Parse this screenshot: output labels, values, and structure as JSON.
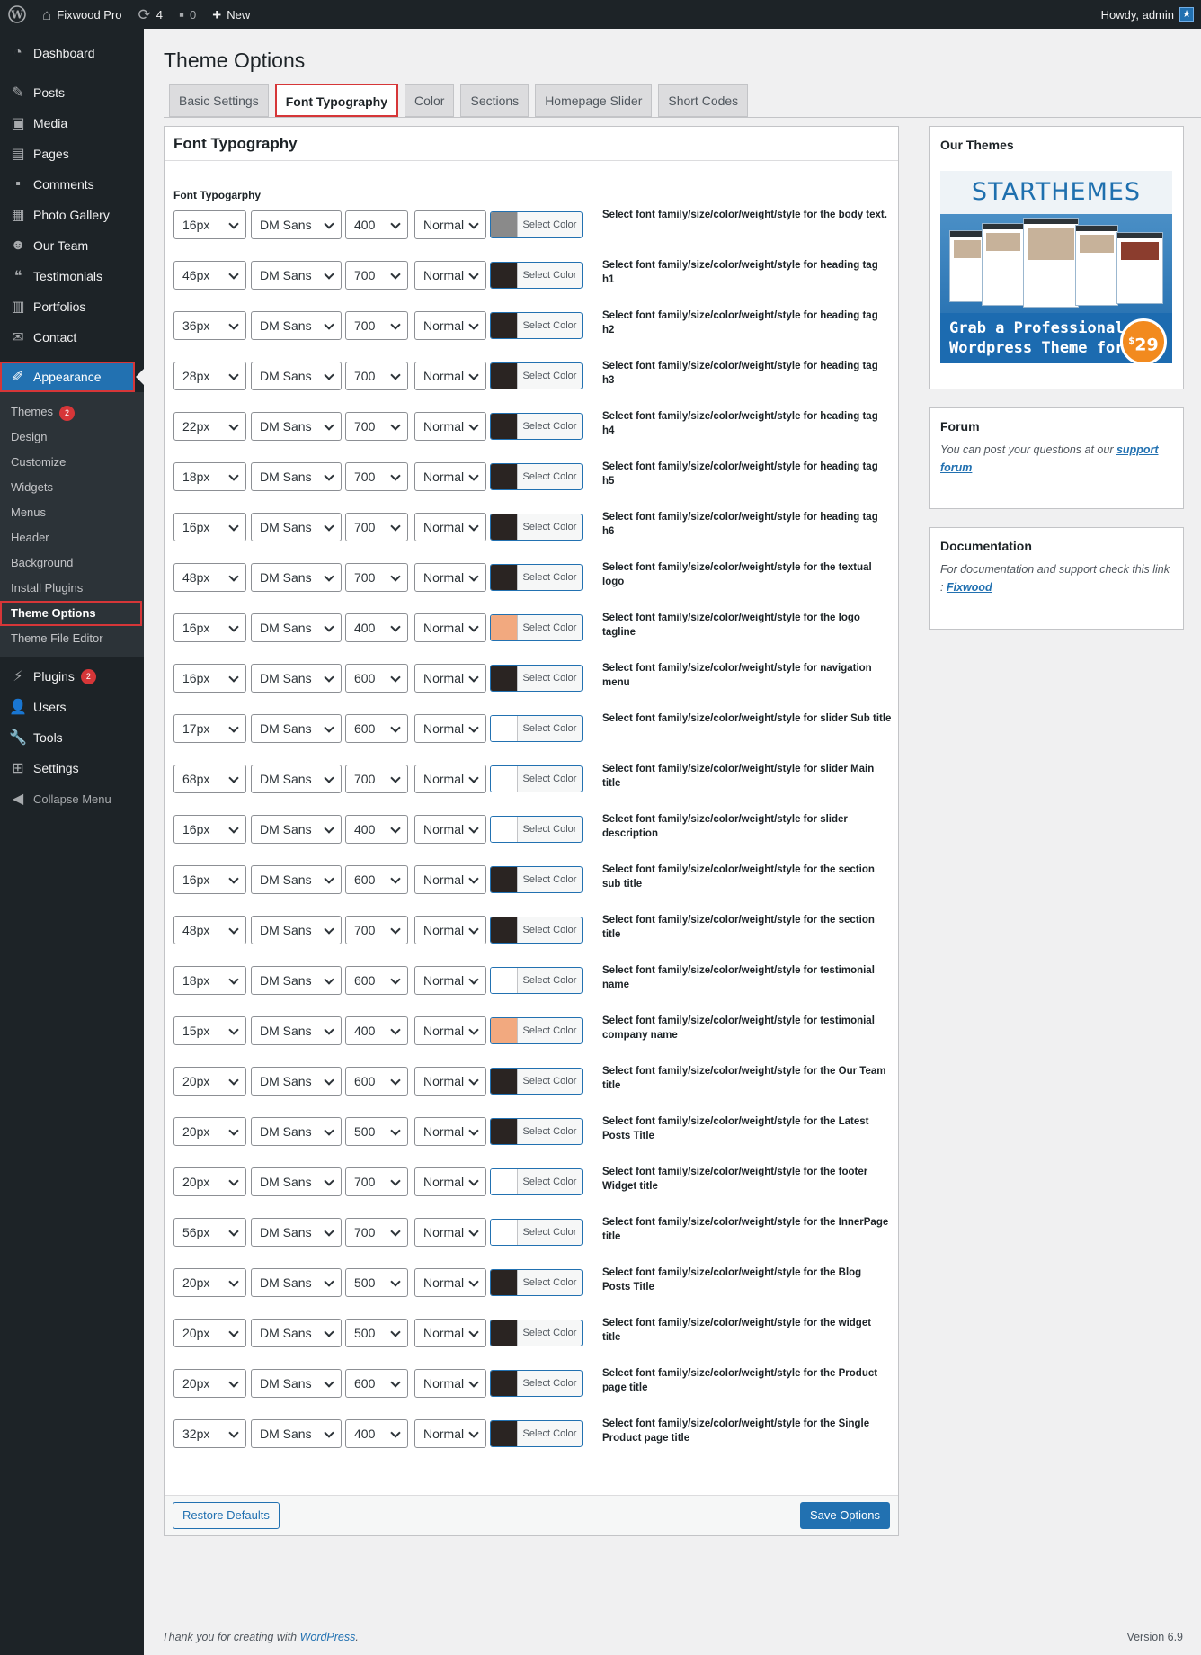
{
  "adminbar": {
    "site_name": "Fixwood Pro",
    "updates_count": "4",
    "comments_count": "0",
    "new_label": "New",
    "howdy": "Howdy, admin"
  },
  "sidebar": {
    "items": [
      {
        "label": "Dashboard",
        "icon": "dashboard-icon"
      },
      {
        "label": "Posts",
        "icon": "pin-icon"
      },
      {
        "label": "Media",
        "icon": "media-icon"
      },
      {
        "label": "Pages",
        "icon": "pages-icon"
      },
      {
        "label": "Comments",
        "icon": "comment-icon"
      },
      {
        "label": "Photo Gallery",
        "icon": "gallery-icon"
      },
      {
        "label": "Our Team",
        "icon": "team-icon"
      },
      {
        "label": "Testimonials",
        "icon": "quote-icon"
      },
      {
        "label": "Portfolios",
        "icon": "portfolio-icon"
      },
      {
        "label": "Contact",
        "icon": "mail-icon"
      },
      {
        "label": "Appearance",
        "icon": "brush-icon"
      }
    ],
    "submenu": [
      {
        "label": "Themes",
        "badge": "2"
      },
      {
        "label": "Design"
      },
      {
        "label": "Customize"
      },
      {
        "label": "Widgets"
      },
      {
        "label": "Menus"
      },
      {
        "label": "Header"
      },
      {
        "label": "Background"
      },
      {
        "label": "Install Plugins"
      },
      {
        "label": "Theme Options"
      },
      {
        "label": "Theme File Editor"
      }
    ],
    "after": [
      {
        "label": "Plugins",
        "icon": "plugin-icon",
        "badge": "2"
      },
      {
        "label": "Users",
        "icon": "user-icon"
      },
      {
        "label": "Tools",
        "icon": "wrench-icon"
      },
      {
        "label": "Settings",
        "icon": "settings-icon"
      }
    ],
    "collapse_label": "Collapse Menu"
  },
  "page": {
    "title": "Theme Options",
    "tabs": [
      "Basic Settings",
      "Font Typography",
      "Color",
      "Sections",
      "Homepage Slider",
      "Short Codes"
    ],
    "panel_title": "Font Typography",
    "section_label": "Font Typogarphy",
    "select_color_label": "Select Color",
    "rows": [
      {
        "size": "16px",
        "family": "DM Sans",
        "weight": "400",
        "style": "Normal",
        "color": "#8a8a8a",
        "desc": "Select font family/size/color/weight/style for the body text."
      },
      {
        "size": "46px",
        "family": "DM Sans",
        "weight": "700",
        "style": "Normal",
        "color": "#2a2422",
        "desc": "Select font family/size/color/weight/style for heading tag h1"
      },
      {
        "size": "36px",
        "family": "DM Sans",
        "weight": "700",
        "style": "Normal",
        "color": "#2a2422",
        "desc": "Select font family/size/color/weight/style for heading tag h2"
      },
      {
        "size": "28px",
        "family": "DM Sans",
        "weight": "700",
        "style": "Normal",
        "color": "#2a2422",
        "desc": "Select font family/size/color/weight/style for heading tag h3"
      },
      {
        "size": "22px",
        "family": "DM Sans",
        "weight": "700",
        "style": "Normal",
        "color": "#2a2422",
        "desc": "Select font family/size/color/weight/style for heading tag h4"
      },
      {
        "size": "18px",
        "family": "DM Sans",
        "weight": "700",
        "style": "Normal",
        "color": "#2a2422",
        "desc": "Select font family/size/color/weight/style for heading tag h5"
      },
      {
        "size": "16px",
        "family": "DM Sans",
        "weight": "700",
        "style": "Normal",
        "color": "#2a2422",
        "desc": "Select font family/size/color/weight/style for heading tag h6"
      },
      {
        "size": "48px",
        "family": "DM Sans",
        "weight": "700",
        "style": "Normal",
        "color": "#2a2422",
        "desc": "Select font family/size/color/weight/style for the textual logo"
      },
      {
        "size": "16px",
        "family": "DM Sans",
        "weight": "400",
        "style": "Normal",
        "color": "#f2a97f",
        "desc": "Select font family/size/color/weight/style for the logo tagline"
      },
      {
        "size": "16px",
        "family": "DM Sans",
        "weight": "600",
        "style": "Normal",
        "color": "#2a2422",
        "desc": "Select font family/size/color/weight/style for navigation menu"
      },
      {
        "size": "17px",
        "family": "DM Sans",
        "weight": "600",
        "style": "Normal",
        "color": "#ffffff",
        "desc": "Select font family/size/color/weight/style for slider Sub title"
      },
      {
        "size": "68px",
        "family": "DM Sans",
        "weight": "700",
        "style": "Normal",
        "color": "#ffffff",
        "desc": "Select font family/size/color/weight/style for slider Main title"
      },
      {
        "size": "16px",
        "family": "DM Sans",
        "weight": "400",
        "style": "Normal",
        "color": "#ffffff",
        "desc": "Select font family/size/color/weight/style for slider description"
      },
      {
        "size": "16px",
        "family": "DM Sans",
        "weight": "600",
        "style": "Normal",
        "color": "#2a2422",
        "desc": "Select font family/size/color/weight/style for the section sub title"
      },
      {
        "size": "48px",
        "family": "DM Sans",
        "weight": "700",
        "style": "Normal",
        "color": "#2a2422",
        "desc": "Select font family/size/color/weight/style for the section title"
      },
      {
        "size": "18px",
        "family": "DM Sans",
        "weight": "600",
        "style": "Normal",
        "color": "#ffffff",
        "desc": "Select font family/size/color/weight/style for testimonial name"
      },
      {
        "size": "15px",
        "family": "DM Sans",
        "weight": "400",
        "style": "Normal",
        "color": "#f2a97f",
        "desc": "Select font family/size/color/weight/style for testimonial company name"
      },
      {
        "size": "20px",
        "family": "DM Sans",
        "weight": "600",
        "style": "Normal",
        "color": "#2a2422",
        "desc": "Select font family/size/color/weight/style for the Our Team title"
      },
      {
        "size": "20px",
        "family": "DM Sans",
        "weight": "500",
        "style": "Normal",
        "color": "#2a2422",
        "desc": "Select font family/size/color/weight/style for the Latest Posts Title"
      },
      {
        "size": "20px",
        "family": "DM Sans",
        "weight": "700",
        "style": "Normal",
        "color": "#ffffff",
        "desc": "Select font family/size/color/weight/style for the footer Widget title"
      },
      {
        "size": "56px",
        "family": "DM Sans",
        "weight": "700",
        "style": "Normal",
        "color": "#ffffff",
        "desc": "Select font family/size/color/weight/style for the InnerPage title"
      },
      {
        "size": "20px",
        "family": "DM Sans",
        "weight": "500",
        "style": "Normal",
        "color": "#2a2422",
        "desc": "Select font family/size/color/weight/style for the Blog Posts Title"
      },
      {
        "size": "20px",
        "family": "DM Sans",
        "weight": "500",
        "style": "Normal",
        "color": "#2a2422",
        "desc": "Select font family/size/color/weight/style for the widget title"
      },
      {
        "size": "20px",
        "family": "DM Sans",
        "weight": "600",
        "style": "Normal",
        "color": "#2a2422",
        "desc": "Select font family/size/color/weight/style for the Product page title"
      },
      {
        "size": "32px",
        "family": "DM Sans",
        "weight": "400",
        "style": "Normal",
        "color": "#2a2422",
        "desc": "Select font family/size/color/weight/style for the Single Product page title"
      }
    ],
    "restore_label": "Restore Defaults",
    "save_label": "Save Options"
  },
  "widgets": {
    "themes": {
      "title": "Our Themes",
      "banner_brand": "STARTHEMES",
      "banner_line1": "Grab a Professional",
      "banner_line2": "Wordpress Theme for",
      "banner_currency": "$",
      "banner_price": "29"
    },
    "forum": {
      "title": "Forum",
      "text": "You can post your questions at our",
      "link": "support forum"
    },
    "docs": {
      "title": "Documentation",
      "text": "For documentation and support check this link :",
      "link": "Fixwood"
    }
  },
  "footer": {
    "thanks": "Thank you for creating with",
    "link": "WordPress",
    "version": "Version 6.9"
  }
}
